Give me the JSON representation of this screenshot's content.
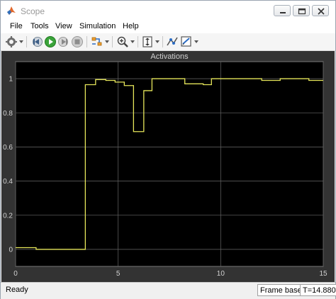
{
  "window": {
    "title": "Scope",
    "controls": [
      "minimize",
      "restore",
      "close"
    ]
  },
  "menu": {
    "items": [
      "File",
      "Tools",
      "View",
      "Simulation",
      "Help"
    ]
  },
  "toolbar": {
    "icons": [
      "settings-icon",
      "step-back-icon",
      "run-icon",
      "step-forward-icon",
      "stop-icon",
      "highlight-icon",
      "zoom-in-icon",
      "autoscale-icon",
      "signal-selector-icon",
      "measurements-icon"
    ]
  },
  "colors": {
    "plot_background": "#000000",
    "figure_background": "#333333",
    "signal": "#e5e55a",
    "grid": "#5a5a5a"
  },
  "chart_data": {
    "type": "line",
    "title": "Activations",
    "xlabel": "",
    "ylabel": "",
    "xlim": [
      0,
      15
    ],
    "ylim": [
      -0.1,
      1.1
    ],
    "x_ticks": [
      "0",
      "5",
      "10",
      "15"
    ],
    "y_ticks": [
      "0",
      "0.2",
      "0.4",
      "0.6",
      "0.8",
      "1"
    ],
    "grid": true,
    "step": true,
    "series": [
      {
        "x": [
          0,
          1,
          3.4,
          3.9,
          4.4,
          4.85,
          5.3,
          5.75,
          6.25,
          6.65,
          7.45,
          8.25,
          9.15,
          9.55,
          10.3,
          12.0,
          12.9,
          14.3,
          15
        ],
        "y": [
          0.01,
          0.0,
          0.965,
          0.995,
          0.99,
          0.98,
          0.96,
          0.69,
          0.93,
          1.0,
          1.0,
          0.97,
          0.965,
          1.0,
          1.0,
          0.99,
          1.0,
          0.99,
          0.99
        ]
      }
    ]
  },
  "status": {
    "text": "Ready",
    "mode": "Frame based",
    "time": "T=14.880"
  }
}
